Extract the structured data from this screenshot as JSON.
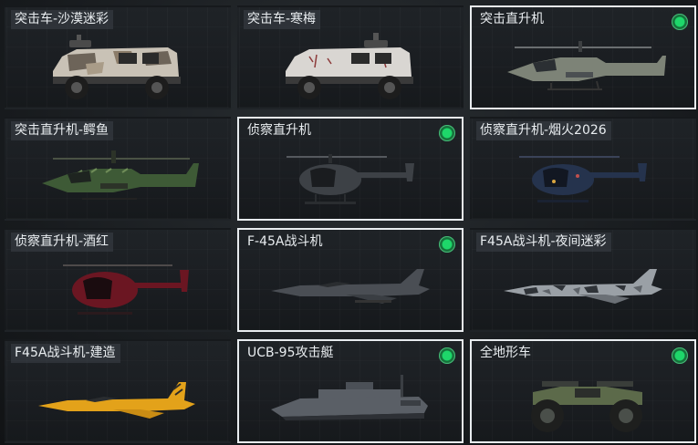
{
  "items": [
    {
      "name": "突击车-沙漠迷彩",
      "icon": "armored-car-desert-camo-icon",
      "owned": false,
      "selected": false
    },
    {
      "name": "突击车-寒梅",
      "icon": "armored-car-winter-plum-icon",
      "owned": false,
      "selected": false
    },
    {
      "name": "突击直升机",
      "icon": "attack-helicopter-icon",
      "owned": true,
      "selected": true
    },
    {
      "name": "突击直升机-鳄鱼",
      "icon": "attack-helicopter-crocodile-icon",
      "owned": false,
      "selected": false
    },
    {
      "name": "侦察直升机",
      "icon": "scout-helicopter-icon",
      "owned": true,
      "selected": true
    },
    {
      "name": "侦察直升机-烟火2026",
      "icon": "scout-helicopter-fireworks-icon",
      "owned": false,
      "selected": false
    },
    {
      "name": "侦察直升机-酒红",
      "icon": "scout-helicopter-burgundy-icon",
      "owned": false,
      "selected": false
    },
    {
      "name": "F-45A战斗机",
      "icon": "fighter-jet-icon",
      "owned": true,
      "selected": true
    },
    {
      "name": "F45A战斗机-夜间迷彩",
      "icon": "fighter-jet-night-camo-icon",
      "owned": false,
      "selected": false
    },
    {
      "name": "F45A战斗机-建造",
      "icon": "fighter-jet-construction-icon",
      "owned": false,
      "selected": false
    },
    {
      "name": "UCB-95攻击艇",
      "icon": "attack-boat-icon",
      "owned": true,
      "selected": true
    },
    {
      "name": "全地形车",
      "icon": "atv-icon",
      "owned": true,
      "selected": true
    }
  ],
  "colors": {
    "owned_indicator": "#1ed76a",
    "selected_border": "#e8ecef",
    "desert_camo": "#c9c2b6",
    "winter_plum": "#d9d6d2",
    "attack_helicopter": "#7d8377",
    "crocodile": "#3e5a36",
    "scout_helicopter": "#3d4146",
    "fireworks": "#25334d",
    "burgundy": "#6b1622",
    "fighter_jet": "#4a4e54",
    "night_camo": "#9aa0a6",
    "construction": "#e3a21a",
    "boat": "#5a5f66",
    "atv": "#5c6a4a"
  }
}
